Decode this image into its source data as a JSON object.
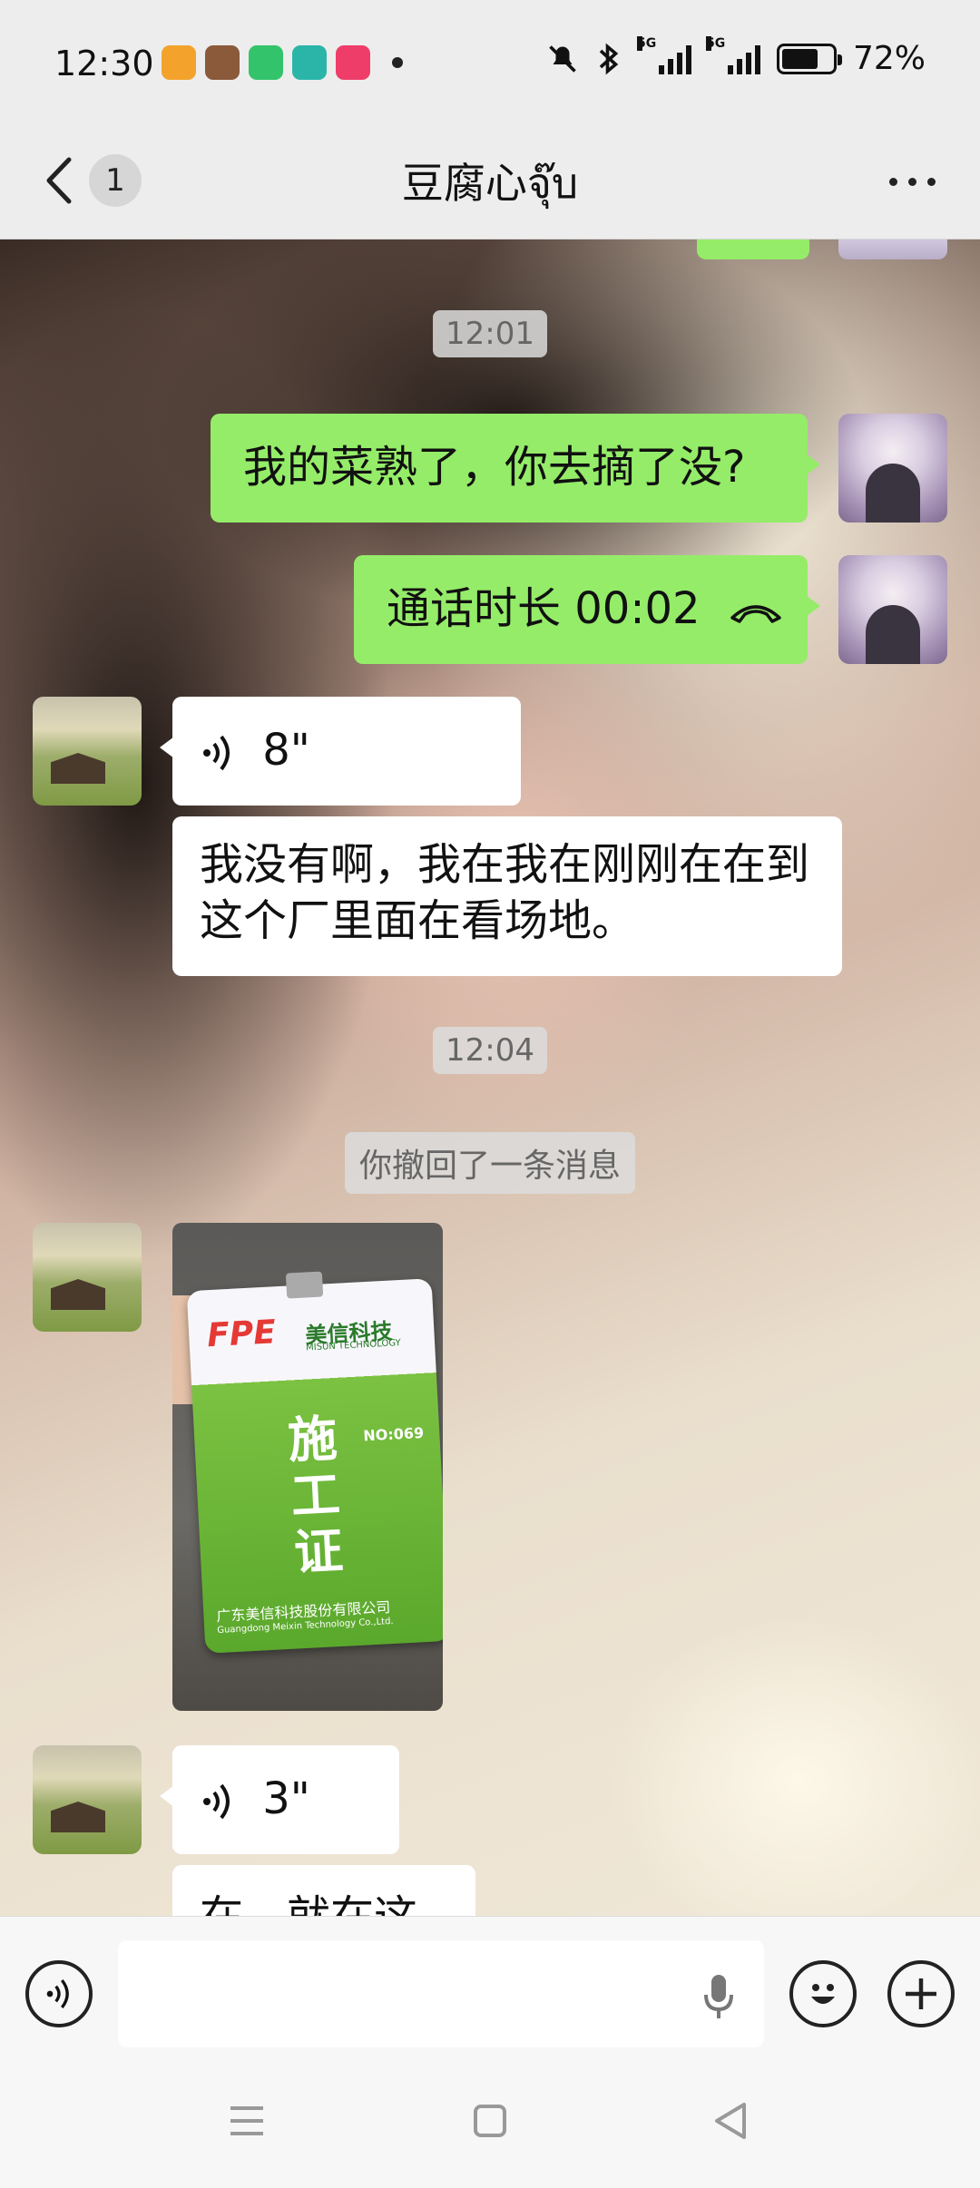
{
  "status_bar": {
    "time": "12:30",
    "battery": "72%",
    "battery_level": 0.72,
    "network_tag_1": "5G",
    "network_tag_2": "5G"
  },
  "header": {
    "unread_count": "1",
    "title": "豆腐心จุ๊บ"
  },
  "messages": {
    "time_1": "12:01",
    "me_text_1": "我的菜熟了，你去摘了没?",
    "me_call": "通话时长 00:02",
    "voice_1_duration": "8\"",
    "them_text_1": "我没有啊，我在我在刚刚在在到这个厂里面在看场地。",
    "time_2": "12:04",
    "recall_notice": "你撤回了一条消息",
    "voice_2_duration": "3\"",
    "them_text_partial": "在，就在这"
  },
  "photo_card": {
    "logo": "FPE",
    "brand": "美信科技",
    "brand_en": "MISUN TECHNOLOGY",
    "number": "NO:069",
    "title_1": "施",
    "title_2": "工",
    "title_3": "证",
    "company": "广东美信科技股份有限公司",
    "company_en": "Guangdong Meixin Technology Co.,Ltd."
  },
  "colors": {
    "my_bubble": "#95ec69",
    "their_bubble": "#ffffff",
    "bar_bg": "#ededed"
  },
  "icons": [
    "back-icon",
    "more-icon",
    "voice-wave-icon",
    "hangup-icon",
    "voice-mode-icon",
    "mic-icon",
    "emoji-icon",
    "plus-icon",
    "menu-icon",
    "home-icon",
    "back-triangle-icon"
  ]
}
